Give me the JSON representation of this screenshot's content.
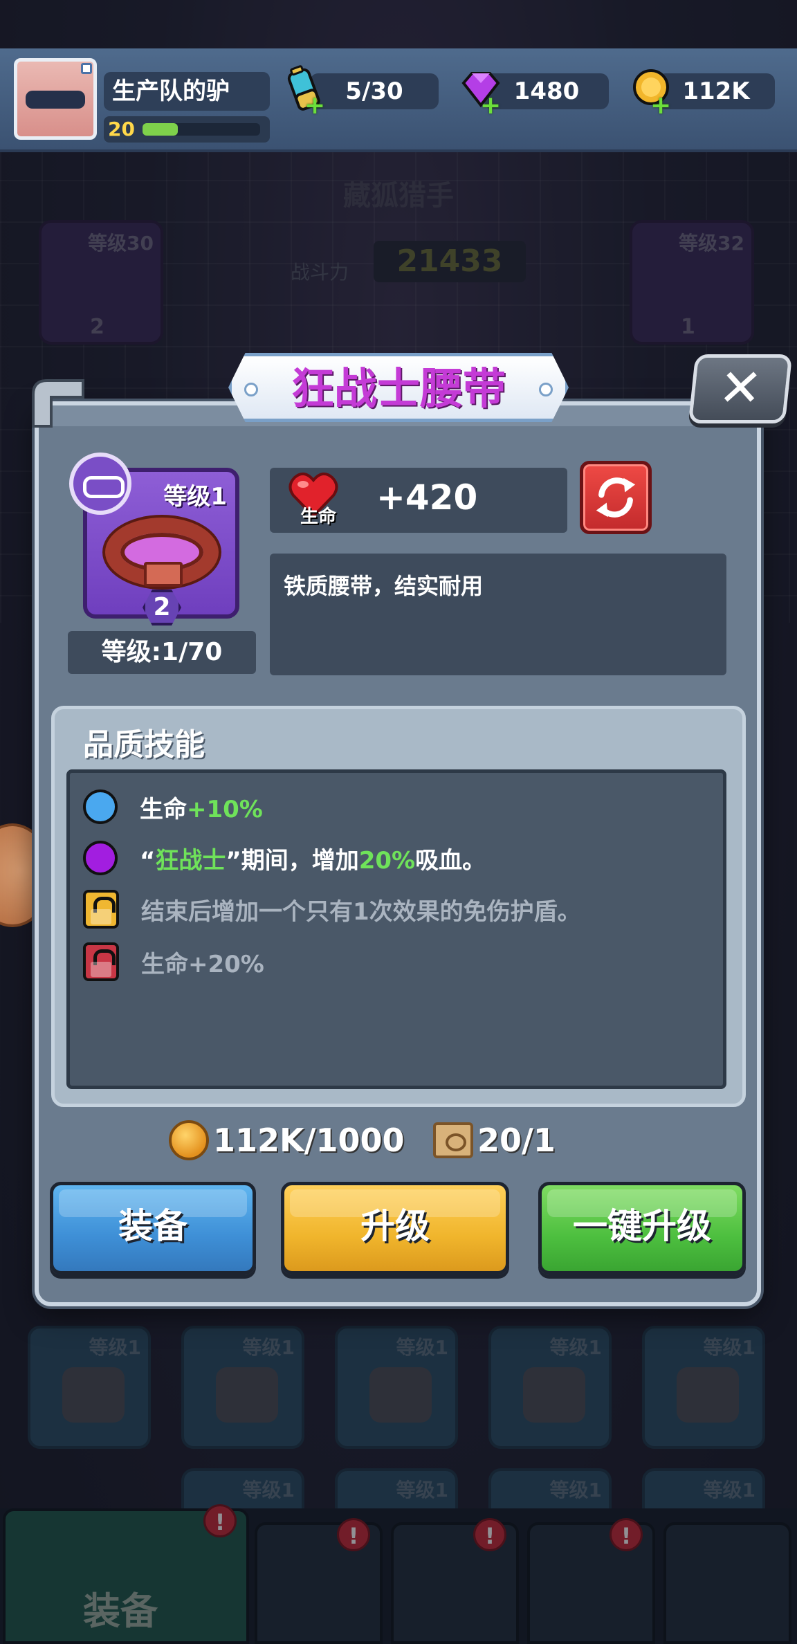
{
  "header": {
    "player_name": "生产队的驴",
    "player_level": "20",
    "xp_fraction": 0.3,
    "energy": "5/30",
    "gems": "1480",
    "gold": "112K"
  },
  "background": {
    "stage_title": "藏狐猎手",
    "power_label": "战斗力",
    "power_value": "21433",
    "slot_left_level": "等级30",
    "slot_left_count": "2",
    "slot_right_level": "等级32",
    "slot_right_count": "1",
    "inventory_level": "等级1",
    "nav_active_label": "装备",
    "nav_badge": "!"
  },
  "dialog": {
    "title": "狂战士腰带",
    "close_label": "✕",
    "item_level_badge": "等级1",
    "item_stars": "2",
    "level_text": "等级:1/70",
    "stat_label": "生命",
    "stat_value": "+420",
    "description": "铁质腰带，结实耐用",
    "skills_title": "品质技能",
    "skills": [
      {
        "prefix": "生命",
        "highlight": "+10%",
        "suffix": "",
        "icon": "blue-dot",
        "color": "#4aa8ef",
        "locked": false
      },
      {
        "prefix": "“",
        "highlight": "狂战士",
        "suffix": "”期间，增加",
        "highlight2": "20%",
        "suffix2": "吸血。",
        "icon": "purple-dot",
        "color": "#a21ee0",
        "locked": false
      },
      {
        "prefix": "结束后增加一个只有1次效果的免伤护盾。",
        "icon": "gold-lock",
        "color": "#f0b731",
        "locked": true
      },
      {
        "prefix": "生命+20%",
        "icon": "red-lock",
        "color": "#c83645",
        "locked": true
      }
    ],
    "cost_gold": "112K/1000",
    "cost_scroll": "20/1",
    "btn_equip": "装备",
    "btn_upgrade": "升级",
    "btn_one_click": "一键升级"
  },
  "colors": {
    "title": "#c43bd6",
    "highlight_green": "#6fe25a",
    "equip_blue": "#3e8fd6",
    "upgrade_yellow": "#f0b52c",
    "one_click_green": "#4dbf3f"
  }
}
